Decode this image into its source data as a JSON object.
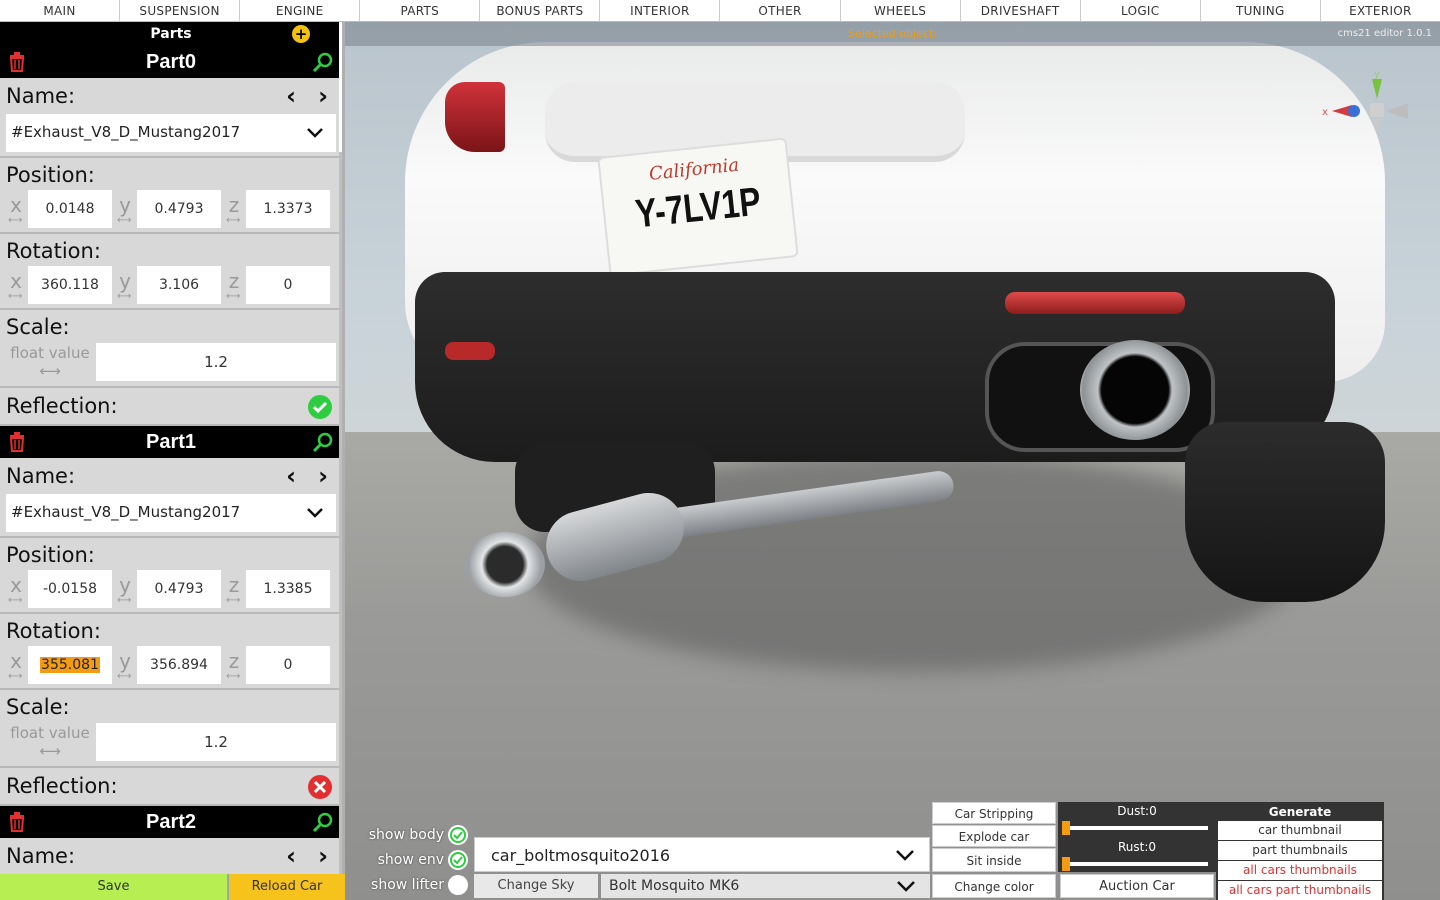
{
  "nav": {
    "tabs": [
      "MAIN",
      "SUSPENSION",
      "ENGINE",
      "PARTS",
      "BONUS PARTS",
      "INTERIOR",
      "OTHER",
      "WHEELS",
      "DRIVESHAFT",
      "LOGIC",
      "TUNING",
      "EXTERIOR"
    ]
  },
  "viewport": {
    "selected_label": "Selected object:",
    "version": "cms21 editor 1.0.1",
    "plate_state": "California",
    "plate_number": "Y-7LV1P",
    "gizmo_axis_y": "y",
    "gizmo_axis_x": "x"
  },
  "panel": {
    "title": "Parts",
    "parts": [
      {
        "header": "Part0",
        "name_label": "Name:",
        "name_value": "#Exhaust_V8_D_Mustang2017",
        "position_label": "Position:",
        "position": {
          "x": "0.0148",
          "y": "0.4793",
          "z": "1.3373"
        },
        "rotation_label": "Rotation:",
        "rotation": {
          "x": "360.118",
          "y": "3.106",
          "z": "0"
        },
        "scale_label": "Scale:",
        "scale_hint": "float value",
        "scale_value": "1.2",
        "reflection_label": "Reflection:",
        "reflection": true
      },
      {
        "header": "Part1",
        "name_label": "Name:",
        "name_value": "#Exhaust_V8_D_Mustang2017",
        "position_label": "Position:",
        "position": {
          "x": "-0.0158",
          "y": "0.4793",
          "z": "1.3385"
        },
        "rotation_label": "Rotation:",
        "rotation": {
          "x": "355.081",
          "y": "356.894",
          "z": "0"
        },
        "scale_label": "Scale:",
        "scale_hint": "float value",
        "scale_value": "1.2",
        "reflection_label": "Reflection:",
        "reflection": false
      },
      {
        "header": "Part2",
        "name_label": "Name:"
      }
    ],
    "axis": {
      "x": "x",
      "y": "y",
      "z": "z"
    }
  },
  "footer": {
    "save": "Save",
    "reload": "Reload Car",
    "show_body": "show body",
    "show_env": "show env",
    "show_lifter": "show lifter",
    "car_select": "car_boltmosquito2016",
    "change_sky": "Change Sky",
    "model_select": "Bolt Mosquito MK6",
    "car_stripping": "Car Stripping",
    "explode_car": "Explode car",
    "sit_inside": "Sit inside",
    "change_color": "Change color",
    "dust": "Dust:0",
    "rust": "Rust:0",
    "auction_car": "Auction Car",
    "generate": "Generate",
    "car_thumbnail": "car thumbnail",
    "part_thumbnails": "part thumbnails",
    "all_cars_thumbnails": "all cars thumbnails",
    "all_cars_part_thumbnails": "all cars part thumbnails"
  },
  "colors": {
    "accent_orange": "#f39c12",
    "check_green": "#2ecc40",
    "error_red": "#e03030",
    "save_green": "#b7ef52",
    "reload_yellow": "#f6c21c"
  }
}
